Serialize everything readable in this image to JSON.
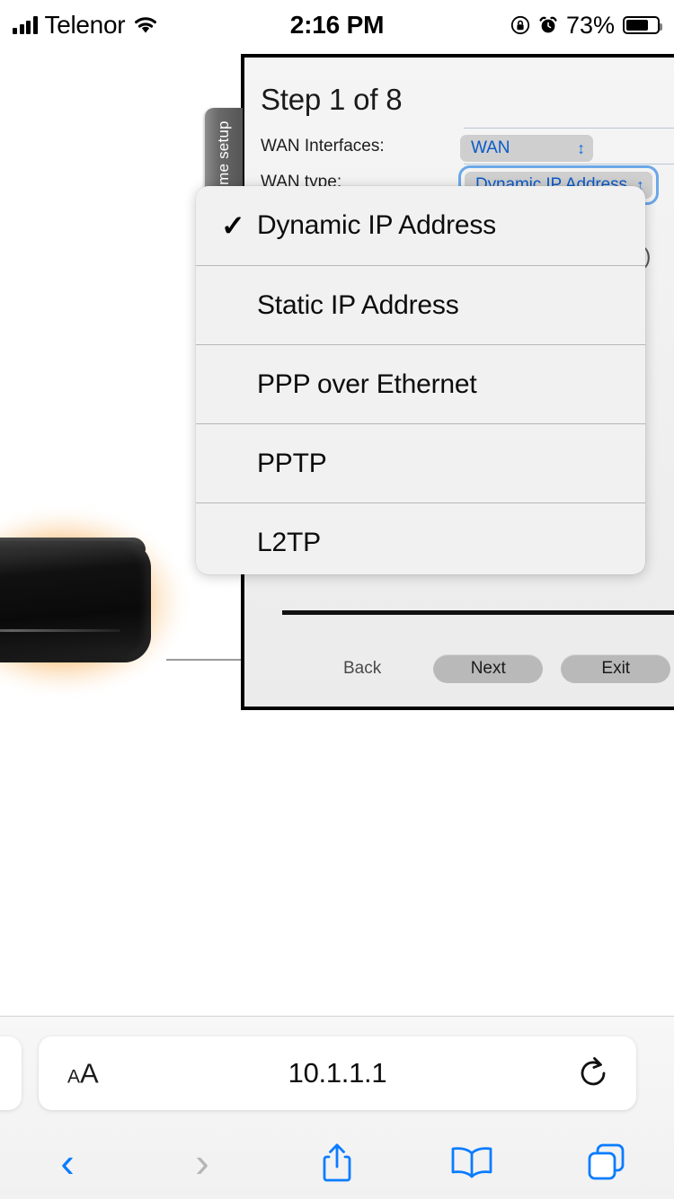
{
  "status_bar": {
    "carrier": "Telenor",
    "time": "2:16 PM",
    "battery_percent": "73%",
    "icons": [
      "signal-bars-icon",
      "wifi-icon",
      "rotation-lock-icon",
      "alarm-clock-icon",
      "battery-icon"
    ]
  },
  "setup": {
    "vertical_tab_label": "First time setup",
    "title": "Step 1 of 8",
    "fields": [
      {
        "label": "WAN Interfaces:",
        "value": "WAN"
      },
      {
        "label": "WAN type:",
        "value": "Dynamic IP Address"
      }
    ],
    "ghost_text": "l)",
    "buttons": {
      "back": "Back",
      "next": "Next",
      "exit": "Exit"
    }
  },
  "select_popup": {
    "selected": "Dynamic IP Address",
    "check_glyph": "✓",
    "options": [
      "Dynamic IP Address",
      "Static IP Address",
      "PPP over Ethernet",
      "PPTP",
      "L2TP"
    ]
  },
  "browser": {
    "text_size_small": "A",
    "text_size_large": "A",
    "url": "10.1.1.1",
    "toolbar_icons": [
      "back-chevron-icon",
      "forward-chevron-icon",
      "share-icon",
      "bookmarks-icon",
      "tabs-icon"
    ],
    "back_glyph": "‹",
    "forward_glyph": "›"
  },
  "colors": {
    "accent_blue": "#0a7cff",
    "select_blue": "#0a5ac9",
    "focus_ring": "#6aa8e8",
    "router_glow": "#f58c19",
    "button_grey": "#b9b9b9"
  }
}
